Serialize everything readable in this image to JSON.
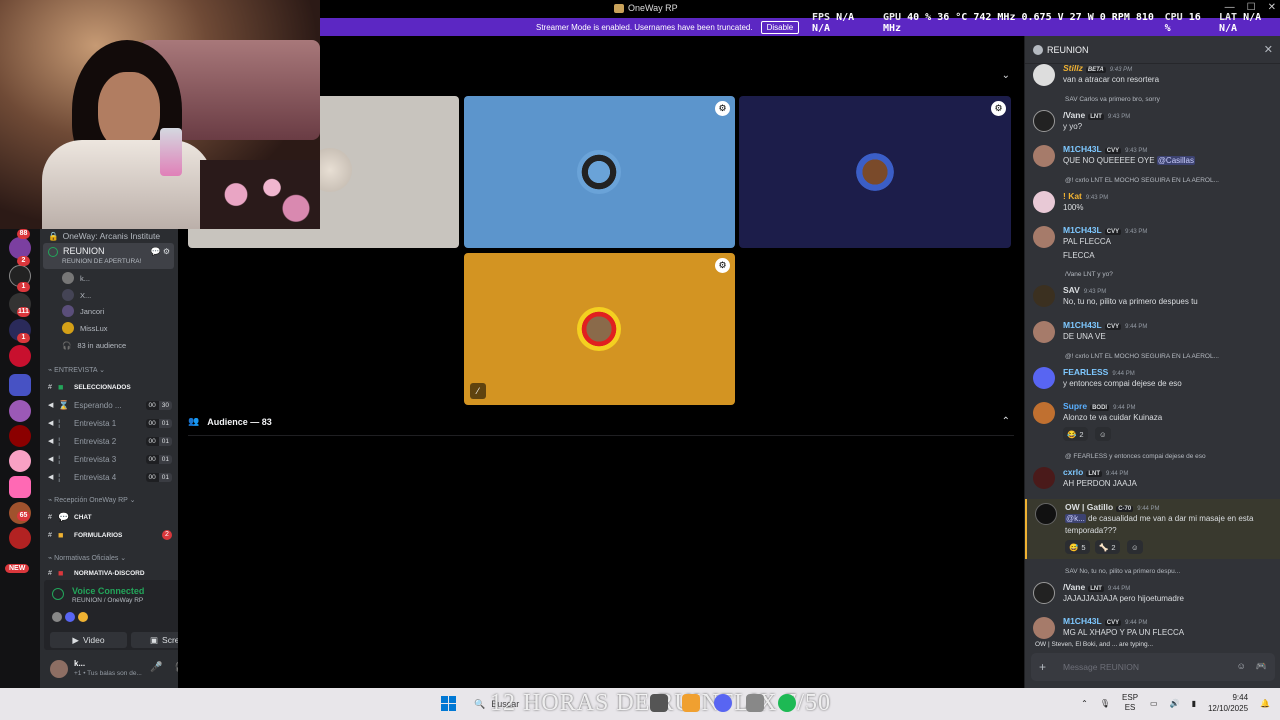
{
  "window": {
    "title": "OneWay RP"
  },
  "perf": {
    "fps_label": "FPS",
    "fps": "N/A N/A",
    "gpu_label": "GPU",
    "gpu": "40 % 36 °C 742 MHz 0.675 V 27 W 0 RPM 810 MHz",
    "cpu_label": "CPU",
    "cpu": "16 %",
    "lat_label": "LAT",
    "lat": "N/A N/A"
  },
  "streamer_bar": {
    "text": "Streamer Mode is enabled. Usernames have been truncated.",
    "button": "Disable"
  },
  "server": {
    "name": "OneWay: Arcanis Institute",
    "stage": {
      "name": "REUNION",
      "subtitle": "REUNION DE APERTURA!"
    },
    "voice_users": [
      "k...",
      "X...",
      "Jancori",
      "MissLux"
    ],
    "audience_count": "83 in audience",
    "categories": {
      "entrevista": "ENTREVISTA",
      "recepcion": "Recepción OneWay RP",
      "normativas": "Normativas Oficiales"
    },
    "channels": [
      {
        "label": "SELECCIONADOS"
      },
      {
        "label": "Esperando ...",
        "a": "00",
        "b": "30"
      },
      {
        "label": "Entrevista 1",
        "a": "00",
        "b": "01"
      },
      {
        "label": "Entrevista 2",
        "a": "00",
        "b": "01"
      },
      {
        "label": "Entrevista 3",
        "a": "00",
        "b": "01"
      },
      {
        "label": "Entrevista 4",
        "a": "00",
        "b": "01"
      }
    ],
    "text_channels": [
      {
        "label": "CHAT"
      },
      {
        "label": "FORMULARIOS",
        "badge": "2"
      },
      {
        "label": "NORMATIVA-DISCORD"
      }
    ]
  },
  "server_rail": {
    "badges": [
      "88",
      "2",
      "1",
      "1",
      "111",
      "1",
      "2",
      "65"
    ],
    "new_label": "NEW"
  },
  "voice_panel": {
    "status": "Voice Connected",
    "location": "REUNION / OneWay RP",
    "video": "Video",
    "screen": "Screen"
  },
  "user_panel": {
    "name": "k...",
    "status": "+1 • Tus balas son de..."
  },
  "stage_area": {
    "audience_label": "Audience — 83"
  },
  "chat": {
    "title": "REUNION",
    "messages": [
      {
        "author": "Stillz",
        "tag": "BETA",
        "time": "9:43 PM",
        "text": "van a atracar con resortera"
      },
      {
        "reply": "SAV  Carlos va primero bro, sorry",
        "author": "/Vane",
        "tag": "LNT",
        "time": "9:43 PM",
        "text": "y yo?"
      },
      {
        "author": "M1CH43L",
        "tag": "CVY",
        "time": "9:43 PM",
        "text_pre": "QUE NO QUEEEEE OYE ",
        "mention": "@Casillas"
      },
      {
        "reply": "@! cxrlo  LNT  EL MOCHO SEGUIRA EN LA AEROL...",
        "author": "! Kat",
        "time": "9:43 PM",
        "text": "100%"
      },
      {
        "author": "M1CH43L",
        "tag": "CVY",
        "time": "9:43 PM",
        "text": "PAL FLECCA",
        "text2": "FLECCA"
      },
      {
        "reply": "/Vane  LNT  y yo?",
        "author": "SAV",
        "time": "9:43 PM",
        "text": "No, tu no, pilito va primero despues tu"
      },
      {
        "author": "M1CH43L",
        "tag": "CVY",
        "time": "9:44 PM",
        "text": "DE UNA VE"
      },
      {
        "reply": "@! cxrlo  LNT  EL MOCHO SEGUIRA EN LA AEROL...",
        "author": "FEARLESS",
        "time": "9:44 PM",
        "text": "y entonces compai dejese de eso"
      },
      {
        "author": "Supre",
        "tag": "BODI",
        "time": "9:44 PM",
        "text": "Alonzo te va cuidar Kuinaza",
        "react": "2"
      },
      {
        "reply": "@ FEARLESS  y entonces compai dejese de eso",
        "author": "cxrlo",
        "tag": "LNT",
        "time": "9:44 PM",
        "text": "AH PERDON JAAJA"
      },
      {
        "author": "OW | Gatillo",
        "tag": "C-70",
        "time": "9:44 PM",
        "mention": "@k...",
        "text_post": " de casualidad me van a dar mi masaje en esta",
        "text2": "temporada???",
        "react1": "5",
        "react2": "2"
      },
      {
        "reply": "SAV  No, tu no, pilito va primero despu...",
        "author": "/Vane",
        "tag": "LNT",
        "time": "9:44 PM",
        "text": "JAJAJJAJJAJA pero hijoetumadre"
      },
      {
        "author": "M1CH43L",
        "tag": "CVY",
        "time": "9:44 PM",
        "text": "MG AL XHAPO Y PA UN FLECCA"
      }
    ],
    "typing": "OW | Steven, El Boki, and ... are typing...",
    "input_placeholder": "Message REUNION"
  },
  "taskbar": {
    "search": "Buscar",
    "overlay": "12 HORAS DE RUINFLIX 7/50",
    "lang": "ESP",
    "lang2": "ES",
    "time": "9:44",
    "date": "12/10/2025"
  },
  "colors": {
    "accent": "#5865f2",
    "green": "#23a55a",
    "red": "#da373c",
    "streamer": "#5c27c3"
  }
}
